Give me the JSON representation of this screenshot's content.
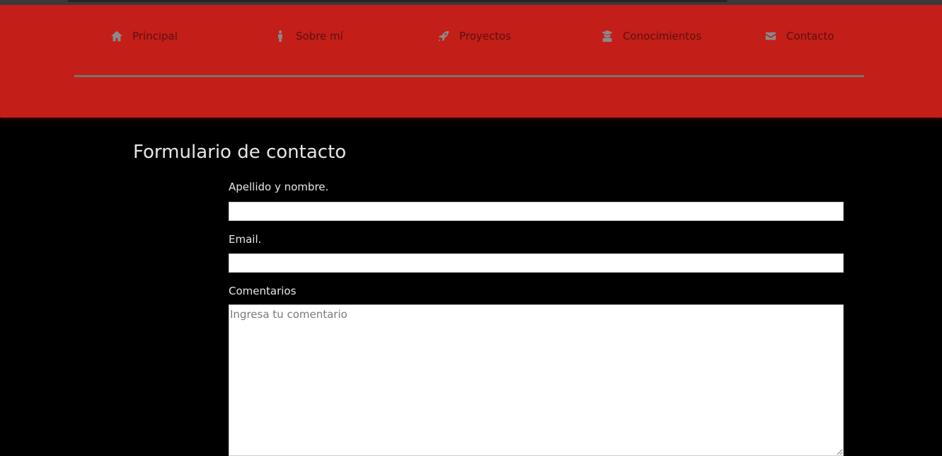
{
  "nav": {
    "items": [
      {
        "label": "Principal",
        "icon": "home-icon"
      },
      {
        "label": "Sobre mí",
        "icon": "person-icon"
      },
      {
        "label": "Proyectos",
        "icon": "rocket-icon"
      },
      {
        "label": "Conocimientos",
        "icon": "graduate-icon"
      },
      {
        "label": "Contacto",
        "icon": "envelope-icon"
      }
    ]
  },
  "form": {
    "title": "Formulario de contacto",
    "name_label": "Apellido y nombre.",
    "name_value": "",
    "email_label": "Email.",
    "email_value": "",
    "comments_label": "Comentarios",
    "comments_placeholder": "Ingresa tu comentario"
  },
  "colors": {
    "header": "#c31e18",
    "background": "#000000",
    "nav_text": "#5a1110",
    "icon": "#8a8a8a"
  }
}
